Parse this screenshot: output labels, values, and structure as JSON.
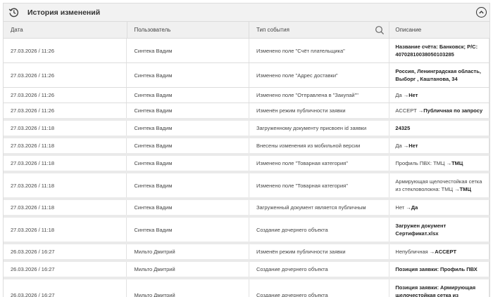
{
  "header": {
    "title": "История изменений"
  },
  "columns": {
    "date": "Дата",
    "user": "Пользователь",
    "event": "Тип события",
    "desc": "Описание"
  },
  "rows": [
    {
      "date": "27.03.2026 / 11:26",
      "user": "Синтека Вадим",
      "event": "Изменено поле \"Счёт плательщика\"",
      "old": "",
      "arrow": "",
      "new": "Название счёта: Банковск; Р/С: 40702810038050103285",
      "h": 34,
      "sep": false
    },
    {
      "date": "27.03.2026 / 11:26",
      "user": "Синтека Вадим",
      "event": "Изменено поле \"Адрес доставки\"",
      "old": "",
      "arrow": "",
      "new": "Россия, Ленинградская область, Выборг , Каштанова, 34",
      "h": 34,
      "sep": false
    },
    {
      "date": "27.03.2026 / 11:26",
      "user": "Синтека Вадим",
      "event": "Изменено поле \"Отправлена в \"Закупай\"\"",
      "old": "Да ",
      "arrow": "→",
      "new": "Нет",
      "h": 21,
      "sep": false
    },
    {
      "date": "27.03.2026 / 11:26",
      "user": "Синтека Вадим",
      "event": "Изменён режим публичности заявки",
      "old": "ACCEPT ",
      "arrow": "→",
      "new": "Публичная по запросу",
      "h": 21,
      "sep": true
    },
    {
      "date": "27.03.2026 / 11:18",
      "user": "Синтека Вадим",
      "event": "Загруженному документу присвоен id заявки",
      "old": "",
      "arrow": "",
      "new": "24325",
      "h": 21,
      "sep": true
    },
    {
      "date": "27.03.2026 / 11:18",
      "user": "Синтека Вадим",
      "event": "Внесены изменения из мобильной версии",
      "old": "Да ",
      "arrow": "→",
      "new": "Нет",
      "h": 21,
      "sep": true
    },
    {
      "date": "27.03.2026 / 11:18",
      "user": "Синтека Вадим",
      "event": "Изменено поле \"Товарная категория\"",
      "old": "Профиль ПВХ: ТМЦ ",
      "arrow": "→",
      "new": "ТМЦ",
      "h": 21,
      "sep": true
    },
    {
      "date": "27.03.2026 / 11:18",
      "user": "Синтека Вадим",
      "event": "Изменено поле \"Товарная категория\"",
      "old": "Армирующая щелочестойкая сетка из стекловолокна: ТМЦ ",
      "arrow": "→",
      "new": "ТМЦ",
      "h": 34,
      "sep": true
    },
    {
      "date": "27.03.2026 / 11:18",
      "user": "Синтека Вадим",
      "event": "Загруженный документ является публичным",
      "old": "Нет ",
      "arrow": "→",
      "new": "Да",
      "h": 21,
      "sep": true
    },
    {
      "date": "27.03.2026 / 11:18",
      "user": "Синтека Вадим",
      "event": "Создание дочернего объекта",
      "old": "",
      "arrow": "",
      "new": "Загружен документ Сертификат.xlsx",
      "h": 34,
      "sep": true
    },
    {
      "date": "26.03.2026 / 16:27",
      "user": "Мильто Дмитрий",
      "event": "Изменён режим публичности заявки",
      "old": "Непубличная ",
      "arrow": "→",
      "new": "ACCEPT",
      "h": 21,
      "sep": true
    },
    {
      "date": "26.03.2026 / 16:27",
      "user": "Мильто Дмитрий",
      "event": "Создание дочернего объекта",
      "old": "",
      "arrow": "",
      "new": "Позиция заявки: Профиль ПВХ",
      "h": 21,
      "sep": true
    },
    {
      "date": "26.03.2026 / 16:27",
      "user": "Мильто Дмитрий",
      "event": "Создание дочернего объекта",
      "old": "",
      "arrow": "",
      "new": "Позиция заявки: Армирующая щелочестойкая сетка из стекловолокна",
      "h": 44,
      "sep": false
    }
  ]
}
